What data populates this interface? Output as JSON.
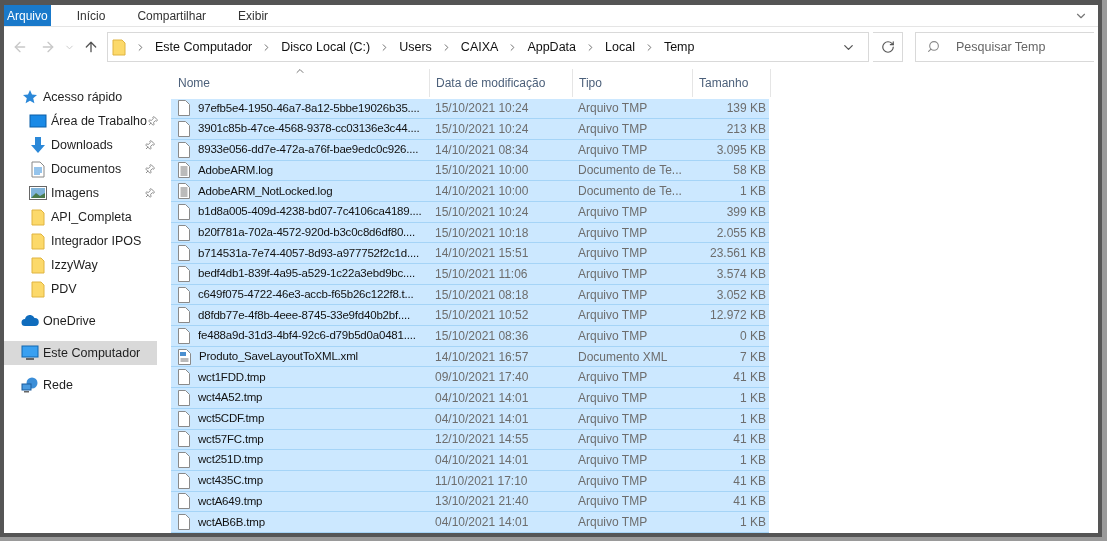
{
  "ribbon_tabs": [
    {
      "label": "Arquivo",
      "kind": "file"
    },
    {
      "label": "Início",
      "kind": "tab"
    },
    {
      "label": "Compartilhar",
      "kind": "tab"
    },
    {
      "label": "Exibir",
      "kind": "tab"
    }
  ],
  "navigation": {
    "back_disabled": true,
    "forward_disabled": true
  },
  "breadcrumbs": [
    "Este Computador",
    "Disco Local (C:)",
    "Users",
    "CAIXA",
    "AppData",
    "Local",
    "Temp"
  ],
  "search": {
    "placeholder": "Pesquisar Temp"
  },
  "sidebar": {
    "items": [
      {
        "label": "Acesso rápido",
        "kind": "star",
        "selected": false,
        "children": [
          {
            "label": "Área de Trabalho",
            "kind": "desktop",
            "pinned": true,
            "selected": false
          },
          {
            "label": "Downloads",
            "kind": "download",
            "pinned": true,
            "selected": false
          },
          {
            "label": "Documentos",
            "kind": "document",
            "pinned": true,
            "selected": false
          },
          {
            "label": "Imagens",
            "kind": "image",
            "pinned": true,
            "selected": false
          },
          {
            "label": "API_Completa",
            "kind": "folder",
            "pinned": false,
            "selected": false
          },
          {
            "label": "Integrador IPOS",
            "kind": "folder",
            "pinned": false,
            "selected": false
          },
          {
            "label": "IzzyWay",
            "kind": "folder",
            "pinned": false,
            "selected": false
          },
          {
            "label": "PDV",
            "kind": "folder",
            "pinned": false,
            "selected": false
          }
        ]
      },
      {
        "label": "OneDrive",
        "kind": "cloud",
        "selected": false
      },
      {
        "label": "Este Computador",
        "kind": "computer",
        "selected": true
      },
      {
        "label": "Rede",
        "kind": "network",
        "selected": false
      }
    ]
  },
  "table": {
    "columns": [
      {
        "label": "Nome",
        "sorted": true
      },
      {
        "label": "Data de modificação",
        "sorted": false
      },
      {
        "label": "Tipo",
        "sorted": false
      },
      {
        "label": "Tamanho",
        "sorted": false
      }
    ],
    "rows": [
      {
        "name": "97efb5e4-1950-46a7-8a12-5bbe19026b35....",
        "date": "15/10/2021 10:24",
        "type": "Arquivo TMP",
        "size": "139 KB",
        "kind": "tmp",
        "selected": true
      },
      {
        "name": "3901c85b-47ce-4568-9378-cc03136e3c44....",
        "date": "15/10/2021 10:24",
        "type": "Arquivo TMP",
        "size": "213 KB",
        "kind": "tmp",
        "selected": true
      },
      {
        "name": "8933e056-dd7e-472a-a76f-bae9edc0c926....",
        "date": "14/10/2021 08:34",
        "type": "Arquivo TMP",
        "size": "3.095 KB",
        "kind": "tmp",
        "selected": true
      },
      {
        "name": "AdobeARM.log",
        "date": "15/10/2021 10:00",
        "type": "Documento de Te...",
        "size": "58 KB",
        "kind": "text",
        "selected": true
      },
      {
        "name": "AdobeARM_NotLocked.log",
        "date": "14/10/2021 10:00",
        "type": "Documento de Te...",
        "size": "1 KB",
        "kind": "text",
        "selected": true
      },
      {
        "name": "b1d8a005-409d-4238-bd07-7c4106ca4189....",
        "date": "15/10/2021 10:24",
        "type": "Arquivo TMP",
        "size": "399 KB",
        "kind": "tmp",
        "selected": true
      },
      {
        "name": "b20f781a-702a-4572-920d-b3c0c8d6df80....",
        "date": "15/10/2021 10:18",
        "type": "Arquivo TMP",
        "size": "2.055 KB",
        "kind": "tmp",
        "selected": true
      },
      {
        "name": "b714531a-7e74-4057-8d93-a977752f2c1d....",
        "date": "14/10/2021 15:51",
        "type": "Arquivo TMP",
        "size": "23.561 KB",
        "kind": "tmp",
        "selected": true
      },
      {
        "name": "bedf4db1-839f-4a95-a529-1c22a3ebd9bc....",
        "date": "15/10/2021 11:06",
        "type": "Arquivo TMP",
        "size": "3.574 KB",
        "kind": "tmp",
        "selected": true
      },
      {
        "name": "c649f075-4722-46e3-accb-f65b26c122f8.t...",
        "date": "15/10/2021 08:18",
        "type": "Arquivo TMP",
        "size": "3.052 KB",
        "kind": "tmp",
        "selected": true
      },
      {
        "name": "d8fdb77e-4f8b-4eee-8745-33e9fd40b2bf....",
        "date": "15/10/2021 10:52",
        "type": "Arquivo TMP",
        "size": "12.972 KB",
        "kind": "tmp",
        "selected": true
      },
      {
        "name": "fe488a9d-31d3-4bf4-92c6-d79b5d0a0481....",
        "date": "15/10/2021 08:36",
        "type": "Arquivo TMP",
        "size": "0 KB",
        "kind": "tmp",
        "selected": true
      },
      {
        "name": "Produto_SaveLayoutToXML.xml",
        "date": "14/10/2021 16:57",
        "type": "Documento XML",
        "size": "7 KB",
        "kind": "xml",
        "selected": true
      },
      {
        "name": "wct1FDD.tmp",
        "date": "09/10/2021 17:40",
        "type": "Arquivo TMP",
        "size": "41 KB",
        "kind": "tmp",
        "selected": true
      },
      {
        "name": "wct4A52.tmp",
        "date": "04/10/2021 14:01",
        "type": "Arquivo TMP",
        "size": "1 KB",
        "kind": "tmp",
        "selected": true
      },
      {
        "name": "wct5CDF.tmp",
        "date": "04/10/2021 14:01",
        "type": "Arquivo TMP",
        "size": "1 KB",
        "kind": "tmp",
        "selected": true
      },
      {
        "name": "wct57FC.tmp",
        "date": "12/10/2021 14:55",
        "type": "Arquivo TMP",
        "size": "41 KB",
        "kind": "tmp",
        "selected": true
      },
      {
        "name": "wct251D.tmp",
        "date": "04/10/2021 14:01",
        "type": "Arquivo TMP",
        "size": "1 KB",
        "kind": "tmp",
        "selected": true
      },
      {
        "name": "wct435C.tmp",
        "date": "11/10/2021 17:10",
        "type": "Arquivo TMP",
        "size": "41 KB",
        "kind": "tmp",
        "selected": true
      },
      {
        "name": "wctA649.tmp",
        "date": "13/10/2021 21:40",
        "type": "Arquivo TMP",
        "size": "41 KB",
        "kind": "tmp",
        "selected": true
      },
      {
        "name": "wctAB6B.tmp",
        "date": "04/10/2021 14:01",
        "type": "Arquivo TMP",
        "size": "1 KB",
        "kind": "tmp",
        "selected": true
      }
    ]
  }
}
